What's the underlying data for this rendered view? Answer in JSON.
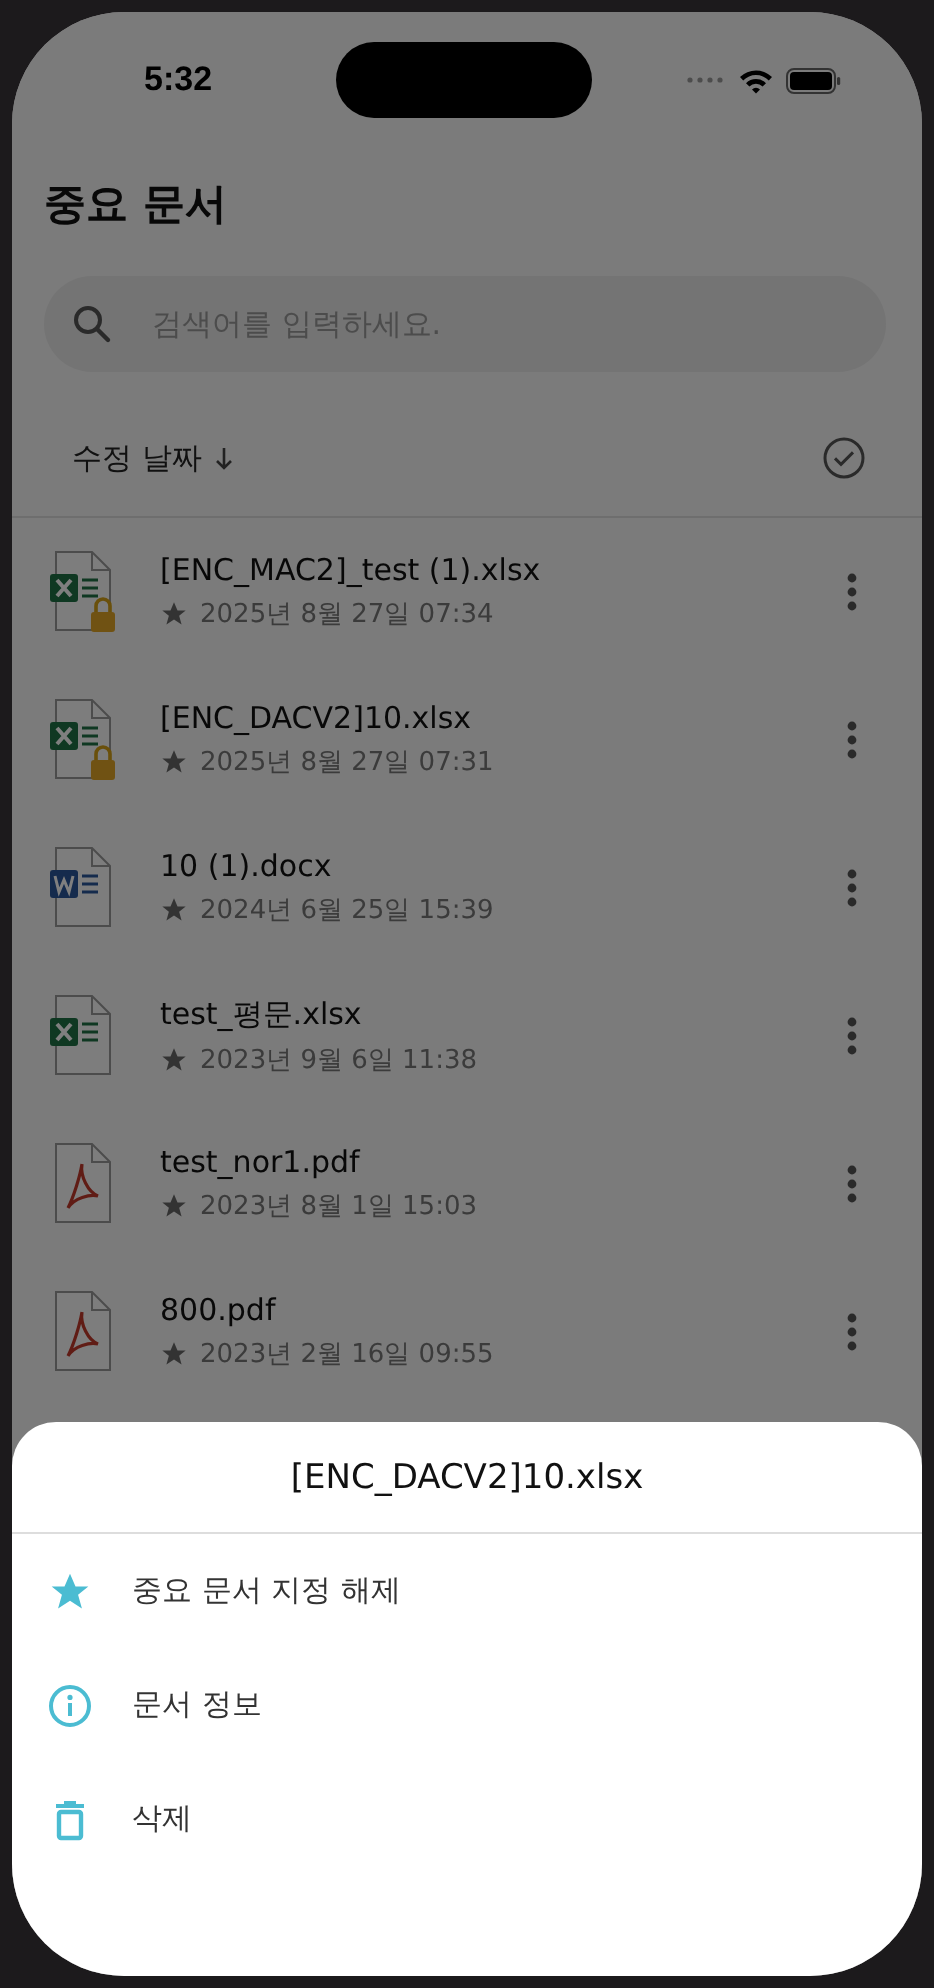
{
  "status_bar": {
    "time": "5:32"
  },
  "title": "중요 문서",
  "search": {
    "placeholder": "검색어를 입력하세요."
  },
  "sort": {
    "label": "수정 날짜"
  },
  "files": [
    {
      "name": "[ENC_MAC2]_test (1).xlsx",
      "date": "2025년 8월 27일 07:34",
      "kind": "excel",
      "locked": true,
      "starred": true
    },
    {
      "name": "[ENC_DACV2]10.xlsx",
      "date": "2025년 8월 27일 07:31",
      "kind": "excel",
      "locked": true,
      "starred": true
    },
    {
      "name": "10 (1).docx",
      "date": "2024년 6월 25일 15:39",
      "kind": "word",
      "locked": false,
      "starred": true
    },
    {
      "name": "test_평문.xlsx",
      "date": "2023년 9월 6일 11:38",
      "kind": "excel",
      "locked": false,
      "starred": true
    },
    {
      "name": "test_nor1.pdf",
      "date": "2023년 8월 1일 15:03",
      "kind": "pdf",
      "locked": false,
      "starred": true
    },
    {
      "name": "800.pdf",
      "date": "2023년 2월 16일 09:55",
      "kind": "pdf",
      "locked": false,
      "starred": true
    }
  ],
  "sheet": {
    "title": "[ENC_DACV2]10.xlsx",
    "actions": [
      {
        "label": "중요 문서 지정 해제",
        "kind": "star"
      },
      {
        "label": "문서 정보",
        "kind": "info"
      },
      {
        "label": "삭제",
        "kind": "trash"
      }
    ]
  }
}
